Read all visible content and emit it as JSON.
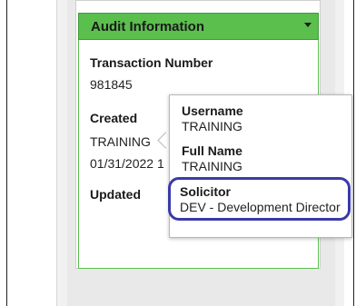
{
  "audit": {
    "header_title": "Audit Information",
    "transaction_label": "Transaction Number",
    "transaction_value": "981845",
    "created_label": "Created",
    "created_by": "TRAINING",
    "created_date": "01/31/2022 1",
    "updated_label": "Updated"
  },
  "popover": {
    "username_label": "Username",
    "username_value": "TRAINING",
    "fullname_label": "Full Name",
    "fullname_value": "TRAINING",
    "solicitor_label": "Solicitor",
    "solicitor_value": "DEV - Development Director"
  },
  "colors": {
    "header_green": "#5bbf4e",
    "highlight_blue": "#3a3aa8"
  },
  "icons": {
    "header_caret": "caret-down-icon"
  }
}
